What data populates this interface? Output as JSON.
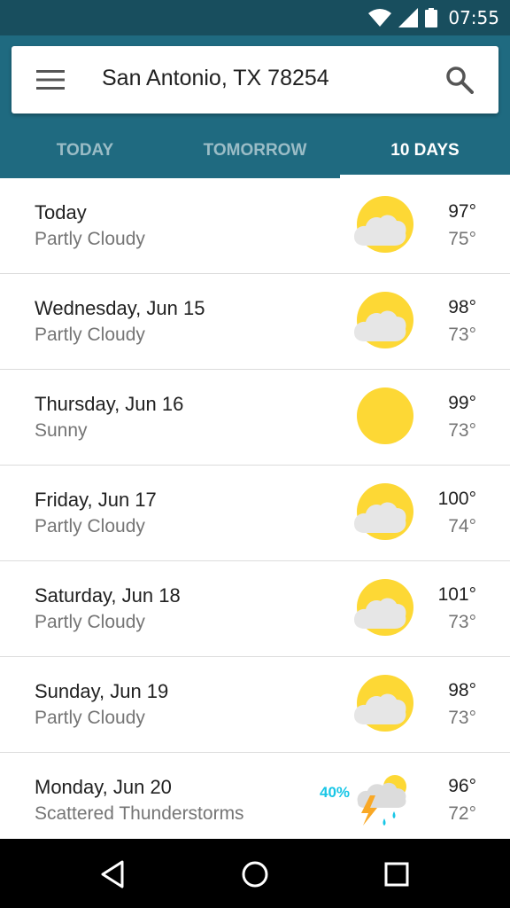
{
  "status_bar": {
    "time": "07:55",
    "icons": [
      "wifi-icon",
      "signal-icon",
      "battery-icon"
    ]
  },
  "search": {
    "location": "San Antonio, TX 78254"
  },
  "tabs": [
    {
      "label": "TODAY",
      "active": false
    },
    {
      "label": "TOMORROW",
      "active": false
    },
    {
      "label": "10 DAYS",
      "active": true
    }
  ],
  "forecast": [
    {
      "day": "Today",
      "condition": "Partly Cloudy",
      "high": "97°",
      "low": "75°",
      "icon": "partly-cloudy-icon"
    },
    {
      "day": "Wednesday, Jun 15",
      "condition": "Partly Cloudy",
      "high": "98°",
      "low": "73°",
      "icon": "partly-cloudy-icon"
    },
    {
      "day": "Thursday, Jun 16",
      "condition": "Sunny",
      "high": "99°",
      "low": "73°",
      "icon": "sunny-icon"
    },
    {
      "day": "Friday, Jun 17",
      "condition": "Partly Cloudy",
      "high": "100°",
      "low": "74°",
      "icon": "partly-cloudy-icon"
    },
    {
      "day": "Saturday, Jun 18",
      "condition": "Partly Cloudy",
      "high": "101°",
      "low": "73°",
      "icon": "partly-cloudy-icon"
    },
    {
      "day": "Sunday, Jun 19",
      "condition": "Partly Cloudy",
      "high": "98°",
      "low": "73°",
      "icon": "partly-cloudy-icon"
    },
    {
      "day": "Monday, Jun 20",
      "condition": "Scattered Thunderstorms",
      "high": "96°",
      "low": "72°",
      "icon": "thunderstorm-icon",
      "precip": "40%"
    }
  ],
  "nav": [
    "back-icon",
    "home-icon",
    "recents-icon"
  ],
  "colors": {
    "status_bar": "#184e5e",
    "header": "#1f6a80",
    "sun": "#fdd835",
    "cloud": "#e6e6e6",
    "precip": "#18c6e6",
    "lightning": "#f9a825"
  }
}
